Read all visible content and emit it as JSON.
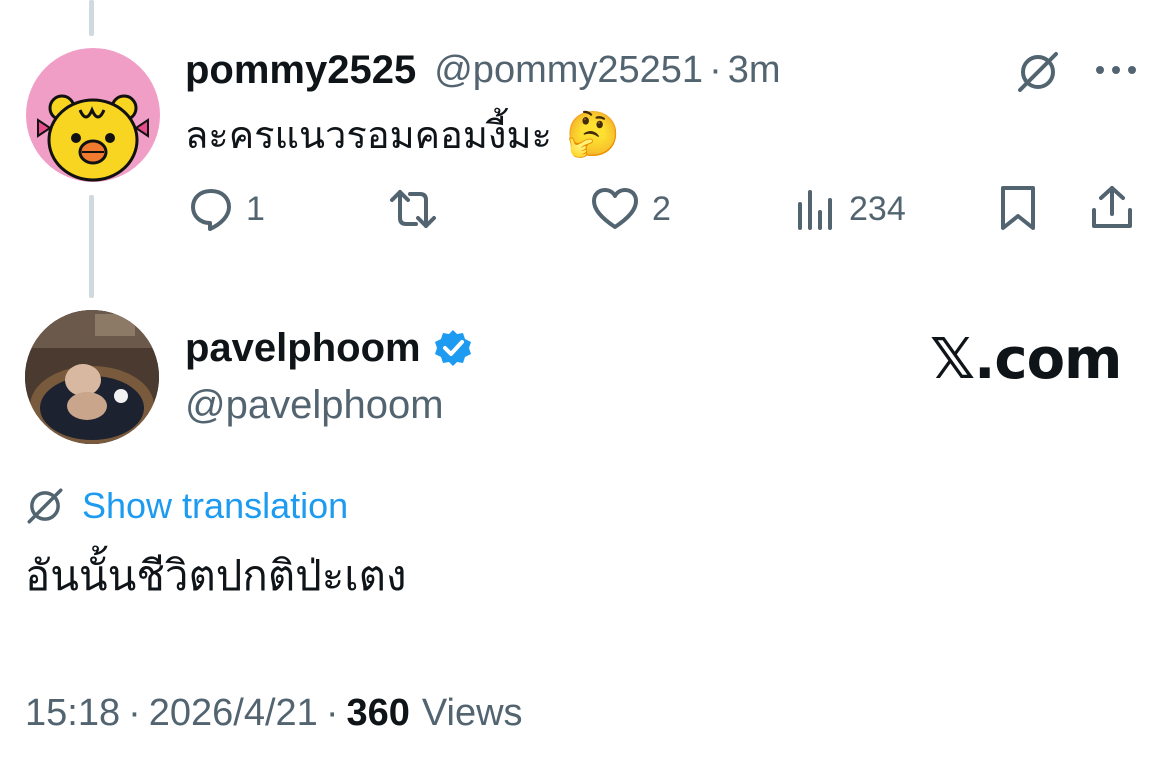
{
  "reply": {
    "display_name": "pommy2525",
    "handle": "@pommy25251",
    "separator": "·",
    "time": "3m",
    "text": "ละครแนวรอมคอมงี้มะ",
    "emoji": "🤔",
    "actions": {
      "replies": "1",
      "reposts": "",
      "likes": "2",
      "views": "234"
    },
    "icons": [
      "translate-icon",
      "more-icon",
      "reply-icon",
      "repost-icon",
      "like-icon",
      "views-icon",
      "bookmark-icon",
      "share-icon"
    ]
  },
  "main": {
    "display_name": "pavelphoom",
    "handle": "@pavelphoom",
    "verified": true,
    "watermark": "𝕏.com",
    "show_translation": "Show translation",
    "text": "อันนั้นชีวิตปกติป่ะเตง",
    "time": "15:18",
    "separator1": "·",
    "date": "2026/4/21",
    "separator2": "·",
    "views_count": "360",
    "views_label": "Views"
  },
  "colors": {
    "text": "#0f1419",
    "muted": "#536471",
    "link": "#1d9bf0",
    "verified": "#1d9bf0",
    "thread_line": "#cfd9de",
    "avatar1_bg": "#f19ec7"
  }
}
